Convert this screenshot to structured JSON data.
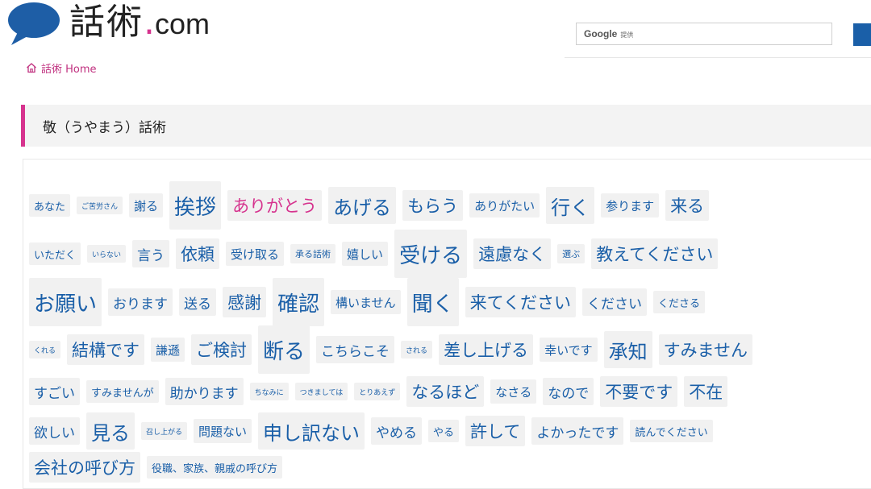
{
  "header": {
    "logo_text": "話術",
    "logo_dot": ".",
    "logo_com": "com",
    "search_brand": "Google",
    "search_provided": "提供"
  },
  "breadcrumb": {
    "home_label": "話術 Home"
  },
  "page": {
    "title": "敬（うやまう）話術"
  },
  "colors": {
    "accent": "#d6338e",
    "link": "#1a5fa8",
    "tag_bg": "#f1f1f1",
    "bubble": "#1e5ea6"
  },
  "tag_rows": [
    [
      {
        "label": "あなた",
        "size": 3
      },
      {
        "label": "ご苦労さん",
        "size": 1
      },
      {
        "label": "謝る",
        "size": 4
      },
      {
        "label": "挨拶",
        "size": 8
      },
      {
        "label": "ありがとう",
        "size": 6,
        "highlight": true
      },
      {
        "label": "あげる",
        "size": 7
      },
      {
        "label": "もらう",
        "size": 6
      },
      {
        "label": "ありがたい",
        "size": 4
      },
      {
        "label": "行く",
        "size": 7
      },
      {
        "label": "参ります",
        "size": 4
      },
      {
        "label": "来る",
        "size": 6
      }
    ],
    [
      {
        "label": "いただく",
        "size": 3
      },
      {
        "label": "いらない",
        "size": 1
      },
      {
        "label": "言う",
        "size": 5
      },
      {
        "label": "依頼",
        "size": 6
      },
      {
        "label": "受け取る",
        "size": 4
      },
      {
        "label": "承る話術",
        "size": 2
      },
      {
        "label": "嬉しい",
        "size": 4
      },
      {
        "label": "受ける",
        "size": 8
      },
      {
        "label": "遠慮なく",
        "size": 6
      },
      {
        "label": "選ぶ",
        "size": 2
      },
      {
        "label": "教えてください",
        "size": 6
      }
    ],
    [
      {
        "label": "お願い",
        "size": 8
      },
      {
        "label": "おります",
        "size": 5
      },
      {
        "label": "送る",
        "size": 5
      },
      {
        "label": "感謝",
        "size": 6
      },
      {
        "label": "確認",
        "size": 8
      },
      {
        "label": "構いません",
        "size": 4
      },
      {
        "label": "聞く",
        "size": 8
      },
      {
        "label": "来てください",
        "size": 6
      },
      {
        "label": "ください",
        "size": 5
      },
      {
        "label": "くださる",
        "size": 3
      }
    ],
    [
      {
        "label": "くれる",
        "size": 1
      },
      {
        "label": "結構です",
        "size": 6
      },
      {
        "label": "謙遜",
        "size": 4
      },
      {
        "label": "ご検討",
        "size": 6
      },
      {
        "label": "断る",
        "size": 8
      },
      {
        "label": "こちらこそ",
        "size": 5
      },
      {
        "label": "される",
        "size": 1
      },
      {
        "label": "差し上げる",
        "size": 6
      },
      {
        "label": "幸いです",
        "size": 4
      },
      {
        "label": "承知",
        "size": 7
      },
      {
        "label": "すみません",
        "size": 6
      }
    ],
    [
      {
        "label": "すごい",
        "size": 5
      },
      {
        "label": "すみませんが",
        "size": 3
      },
      {
        "label": "助かります",
        "size": 5
      },
      {
        "label": "ちなみに",
        "size": 1
      },
      {
        "label": "つきましては",
        "size": 1
      },
      {
        "label": "とりあえず",
        "size": 1
      },
      {
        "label": "なるほど",
        "size": 6
      },
      {
        "label": "なさる",
        "size": 4
      },
      {
        "label": "なので",
        "size": 5
      },
      {
        "label": "不要です",
        "size": 6
      },
      {
        "label": "不在",
        "size": 6
      }
    ],
    [
      {
        "label": "欲しい",
        "size": 5
      },
      {
        "label": "見る",
        "size": 7
      },
      {
        "label": "召し上がる",
        "size": 1
      },
      {
        "label": "問題ない",
        "size": 4
      },
      {
        "label": "申し訳ない",
        "size": 7
      },
      {
        "label": "やめる",
        "size": 5
      },
      {
        "label": "やる",
        "size": 3
      },
      {
        "label": "許して",
        "size": 6
      },
      {
        "label": "よかったです",
        "size": 5
      },
      {
        "label": "読んでください",
        "size": 3
      }
    ],
    [
      {
        "label": "会社の呼び方",
        "size": 6
      },
      {
        "label": "役職、家族、親戚の呼び方",
        "size": 3
      }
    ]
  ]
}
